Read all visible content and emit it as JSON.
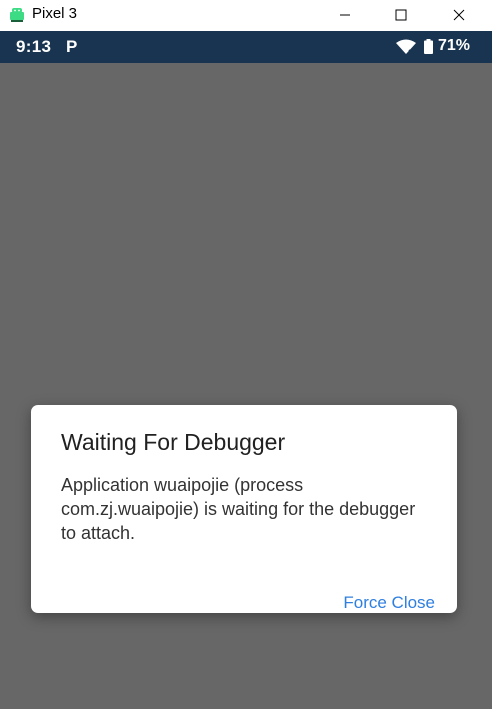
{
  "window": {
    "title": "Pixel 3",
    "icon": "android-emulator-icon",
    "controls": [
      "minimize-icon",
      "maximize-icon",
      "close-icon"
    ]
  },
  "statusbar": {
    "time": "9:13",
    "notification_glyph": "P",
    "wifi_icon": "wifi-icon",
    "battery_icon": "battery-icon",
    "battery_percent": "71%",
    "background": "#183450"
  },
  "dialog": {
    "title": "Waiting For Debugger",
    "message": "Application wuaipojie (process com.zj.wuaipojie) is waiting for the debugger to attach.",
    "button_label": "Force Close",
    "accent": "#2f7fe0"
  },
  "screen_scrim": "#676767"
}
